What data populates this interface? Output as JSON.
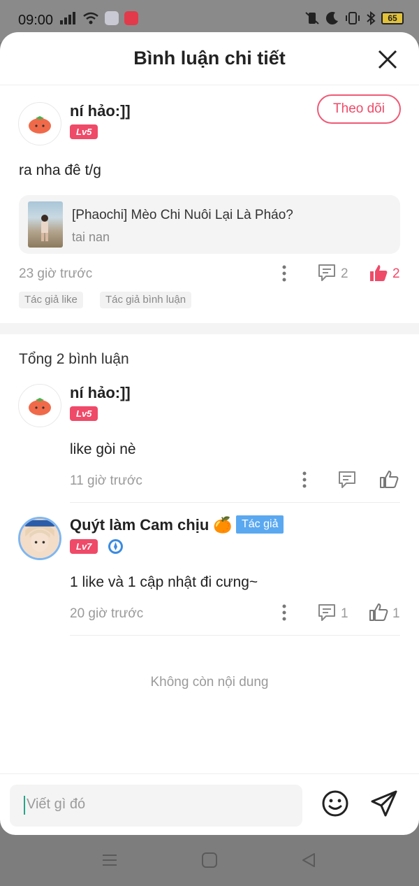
{
  "status_bar": {
    "time": "09:00",
    "battery": "65"
  },
  "header": {
    "title": "Bình luận chi tiết"
  },
  "main_comment": {
    "username": "ní hảo:]]",
    "level": "Lv5",
    "follow_label": "Theo dõi",
    "text": "ra nha đê t/g",
    "story": {
      "title": "[Phaochi] Mèo Chi Nuôi Lại Là Pháo?",
      "subtitle": "tai nan"
    },
    "time": "23 giờ trước",
    "reply_count": "2",
    "like_count": "2",
    "tags": [
      "Tác giả like",
      "Tác giả bình luận"
    ]
  },
  "replies_section": {
    "total": "Tổng 2 bình luận",
    "replies": [
      {
        "username": "ní hảo:]]",
        "level": "Lv5",
        "text": "like gòi nè",
        "time": "11 giờ trước"
      },
      {
        "username": "Quýt làm Cam chịu 🍊",
        "author_badge": "Tác giả",
        "level": "Lv7",
        "text": "1 like và 1 cập nhật đi cưng~",
        "time": "20 giờ trước",
        "reply_count": "1",
        "like_count": "1"
      }
    ],
    "end_text": "Không còn nội dung"
  },
  "composer": {
    "placeholder": "Viết gì đó"
  },
  "colors": {
    "accent": "#ef4a68",
    "author_badge": "#5aa8f0"
  }
}
